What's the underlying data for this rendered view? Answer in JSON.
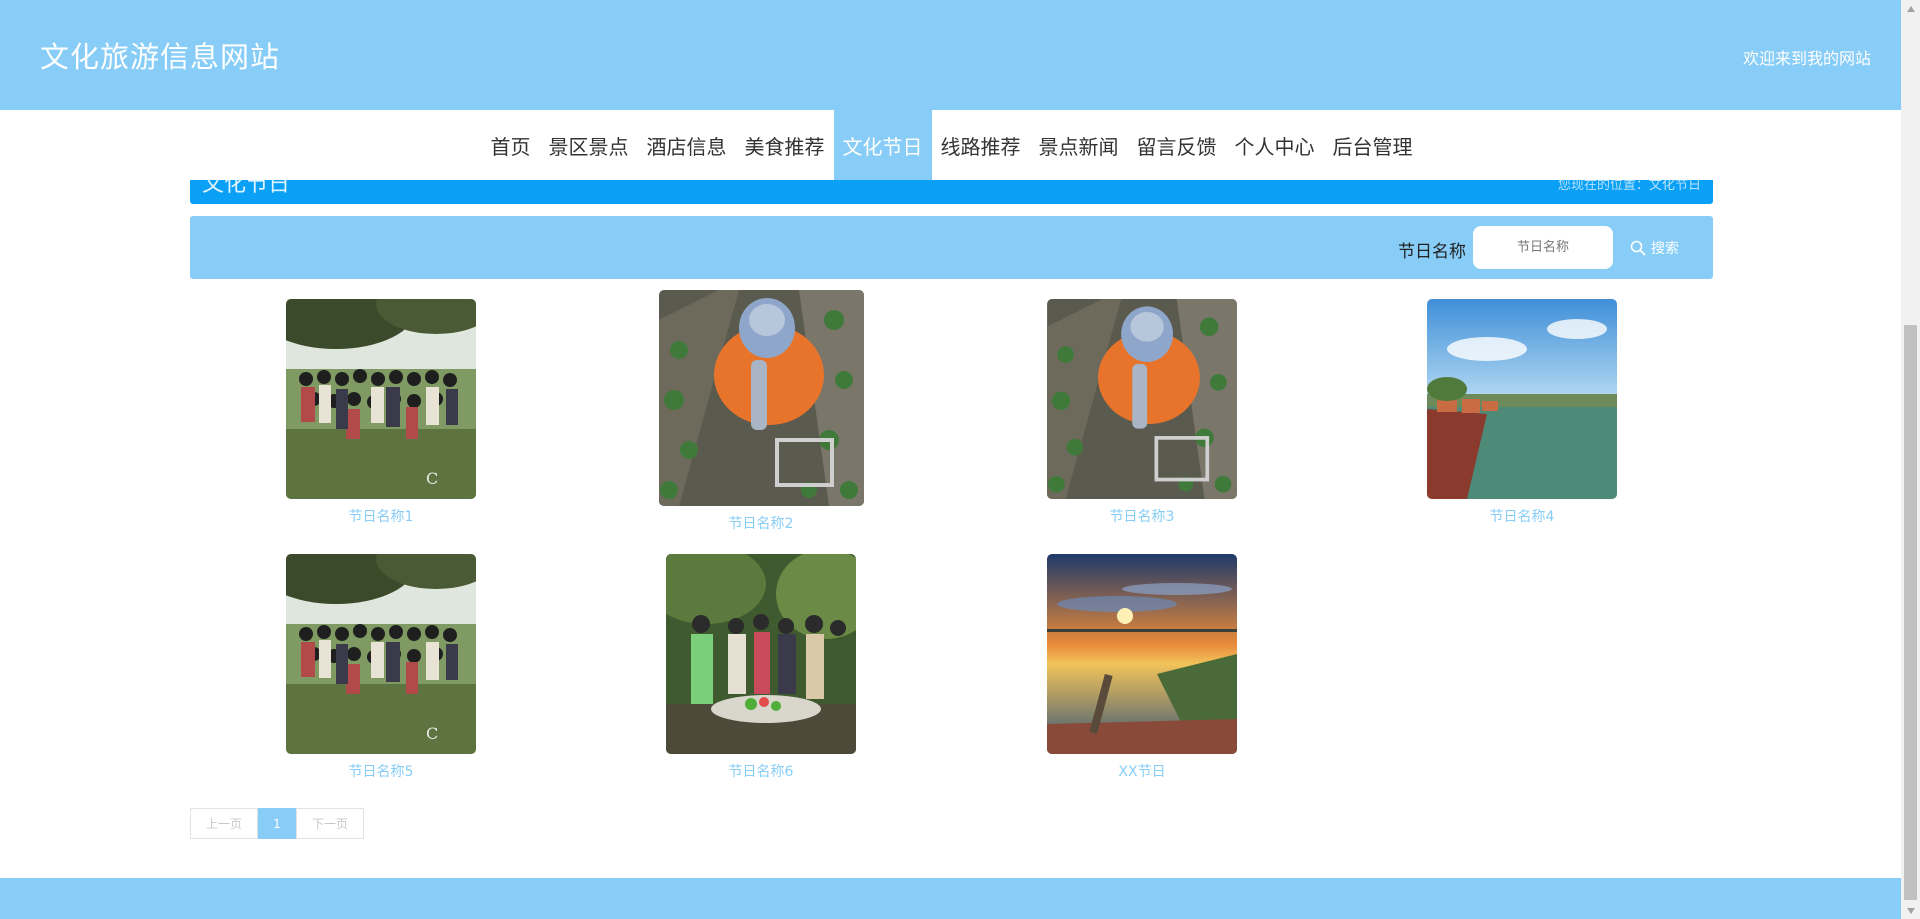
{
  "header": {
    "site_title": "文化旅游信息网站",
    "welcome": "欢迎来到我的网站"
  },
  "nav": {
    "items": [
      {
        "label": "首页"
      },
      {
        "label": "景区景点"
      },
      {
        "label": "酒店信息"
      },
      {
        "label": "美食推荐"
      },
      {
        "label": "文化节日",
        "active": true
      },
      {
        "label": "线路推荐"
      },
      {
        "label": "景点新闻"
      },
      {
        "label": "留言反馈"
      },
      {
        "label": "个人中心"
      },
      {
        "label": "后台管理"
      }
    ]
  },
  "section": {
    "title": "文化节日",
    "breadcrumb": "您现在的位置：文化节日"
  },
  "search": {
    "label": "节日名称",
    "placeholder": "节日名称",
    "button_label": "搜索"
  },
  "festivals": [
    {
      "name": "节日名称1",
      "image": "group-photo-outdoors"
    },
    {
      "name": "节日名称2",
      "image": "child-picking-strawberries"
    },
    {
      "name": "节日名称3",
      "image": "child-picking-strawberries"
    },
    {
      "name": "节日名称4",
      "image": "lakeside-village-scenery"
    },
    {
      "name": "节日名称5",
      "image": "group-photo-outdoors"
    },
    {
      "name": "节日名称6",
      "image": "group-dinner-party"
    },
    {
      "name": "XX节日",
      "image": "sunset-over-lake"
    }
  ],
  "pagination": {
    "prev_label": "上一页",
    "current_page": "1",
    "next_label": "下一页"
  },
  "colors": {
    "brand": "#87cdf7",
    "section_bar": "#0aa0f6",
    "nav_text": "#333333"
  }
}
